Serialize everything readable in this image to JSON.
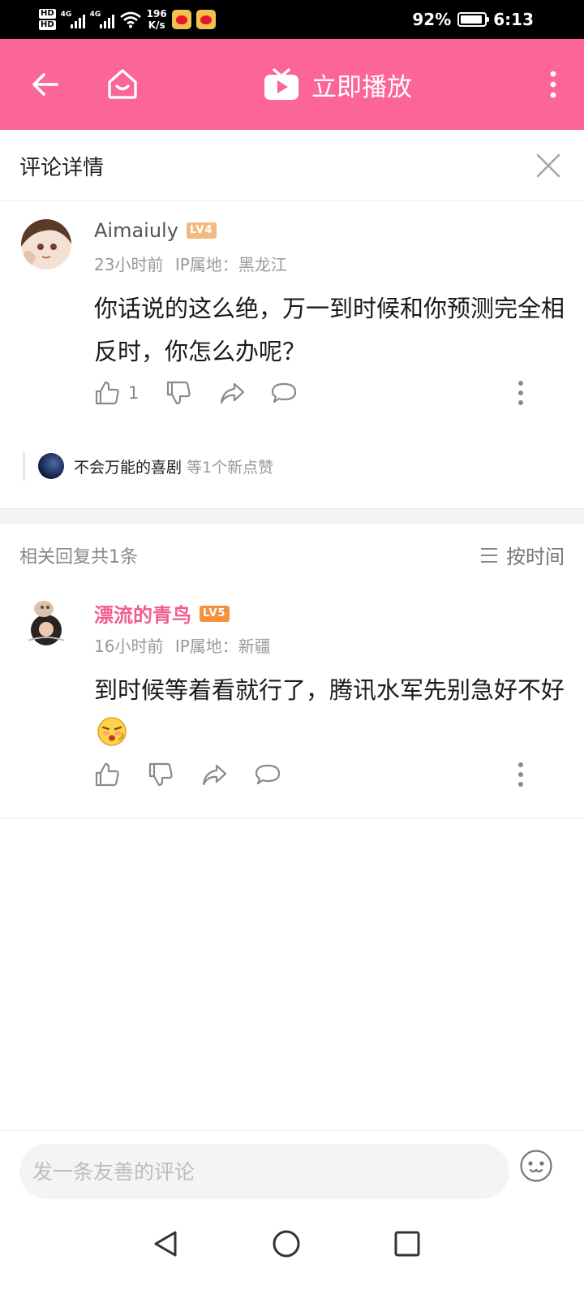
{
  "status": {
    "hd1": "HD",
    "hd2": "HD",
    "net1": "4G",
    "net2": "4G",
    "speed_value": "196",
    "speed_unit": "K/s",
    "battery": "92%",
    "battery_level": 0.92,
    "time": "6:13"
  },
  "appbar": {
    "play_label": "立即播放"
  },
  "panel": {
    "title": "评论详情"
  },
  "main_comment": {
    "username": "Aimaiuly",
    "level": "LV4",
    "time": "23小时前",
    "ip": "IP属地：黑龙江",
    "text": "你话说的这么绝，万一到时候和你预测完全相反时，你怎么办呢？",
    "like_count": "1",
    "likers_name": "不会万能的喜剧",
    "likers_note": "等1个新点赞"
  },
  "replies": {
    "count_label": "相关回复共1条",
    "sort_label": "按时间"
  },
  "reply": {
    "username": "漂流的青鸟",
    "level": "LV5",
    "time": "16小时前",
    "ip": "IP属地：新疆",
    "text": "到时候等着看就行了，腾讯水军先别急好不好"
  },
  "input": {
    "placeholder": "发一条友善的评论"
  },
  "colors": {
    "brand_pink": "#fb6697",
    "lv4": "#f3b97e",
    "lv5": "#f6913e",
    "vip_name": "#f25d8e"
  }
}
